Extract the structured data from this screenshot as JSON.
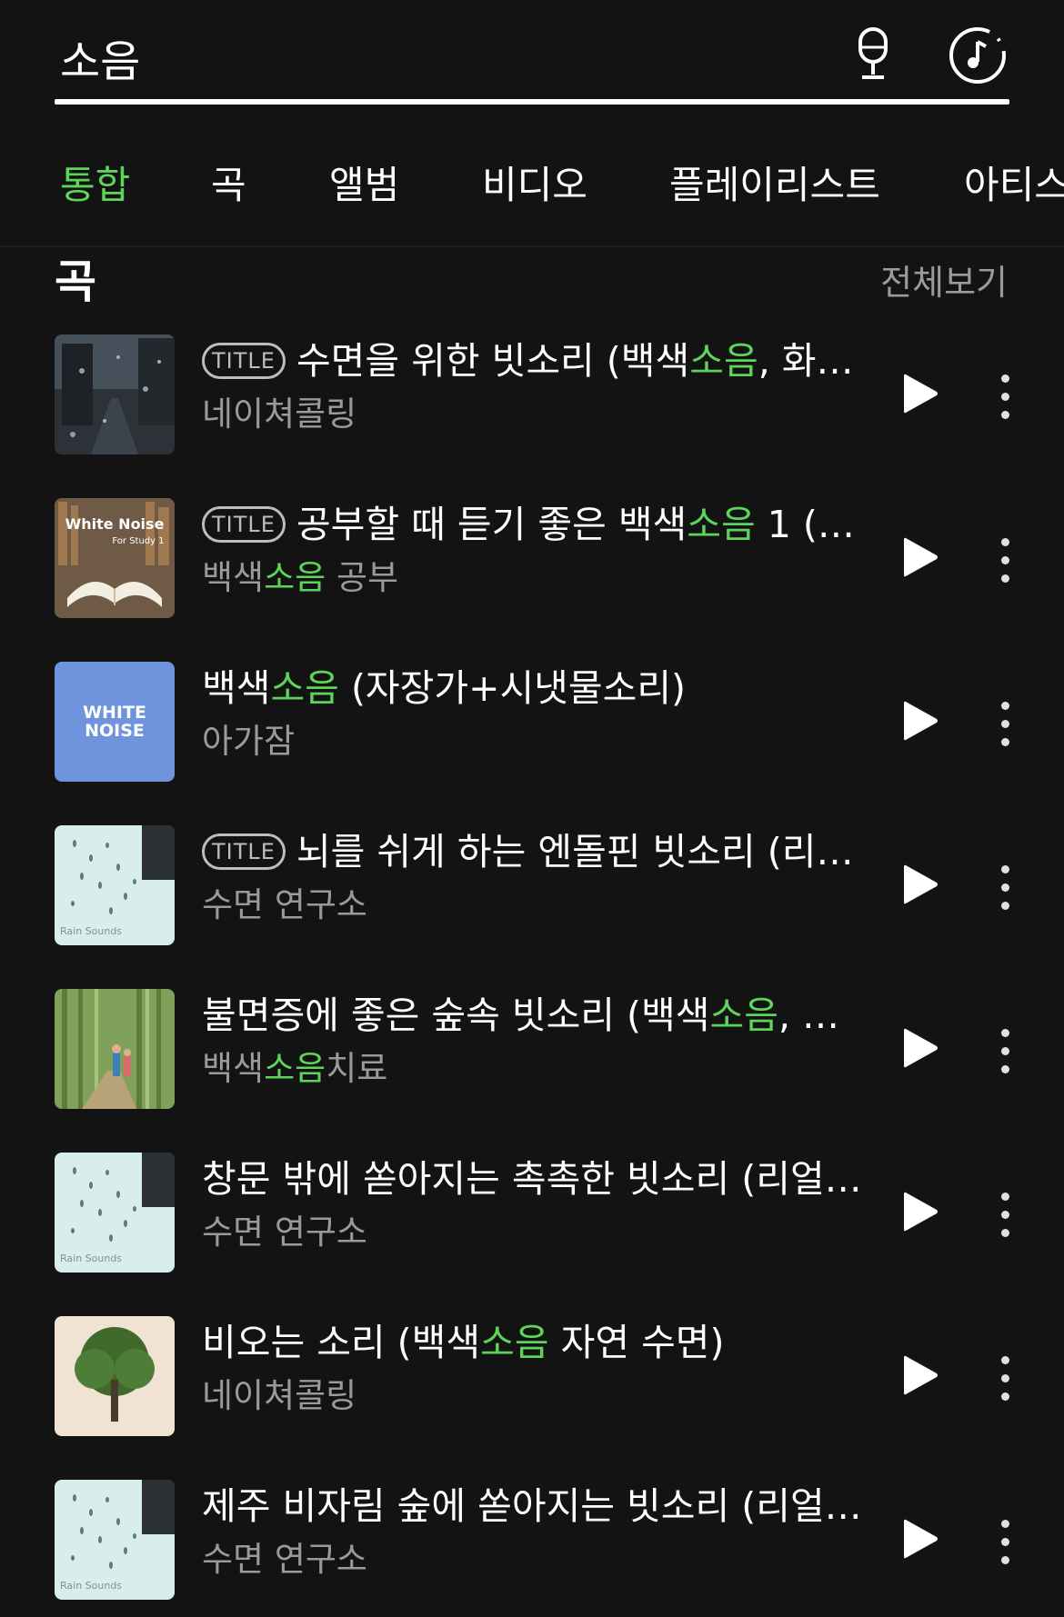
{
  "search": {
    "query": "소음"
  },
  "tabs": [
    {
      "label": "통합",
      "active": true
    },
    {
      "label": "곡",
      "active": false
    },
    {
      "label": "앨범",
      "active": false
    },
    {
      "label": "비디오",
      "active": false
    },
    {
      "label": "플레이리스트",
      "active": false
    },
    {
      "label": "아티스트",
      "active": false
    }
  ],
  "section": {
    "title": "곡",
    "see_all": "전체보기"
  },
  "badge_label": "TITLE",
  "highlight_color": "#5dd45a",
  "songs": [
    {
      "title_parts": [
        "수면을 위한 빗소리 (백색",
        "소음",
        ", 화…"
      ],
      "badge": true,
      "artist_parts": [
        "네이쳐콜링",
        "",
        ""
      ],
      "cover": "rainy-city-street"
    },
    {
      "title_parts": [
        "공부할 때 듣기 좋은 백색",
        "소음",
        " 1 (…"
      ],
      "badge": true,
      "artist_parts": [
        "백색",
        "소음",
        " 공부"
      ],
      "cover": "white-noise-for-study-book",
      "cover_text": [
        "White Noise",
        "For Study 1"
      ]
    },
    {
      "title_parts": [
        "백색",
        "소음",
        " (자장가+시냇물소리)"
      ],
      "badge": false,
      "artist_parts": [
        "아가잠",
        "",
        ""
      ],
      "cover": "white-noise-blue",
      "cover_text": [
        "WHITE",
        "NOISE"
      ]
    },
    {
      "title_parts": [
        "뇌를 쉬게 하는 엔돌핀 빗소리 (리…",
        "",
        ""
      ],
      "badge": true,
      "artist_parts": [
        "수면 연구소",
        "",
        ""
      ],
      "cover": "rain-drops-window",
      "cover_text": [
        "Rain Sounds"
      ]
    },
    {
      "title_parts": [
        "불면증에 좋은 숲속 빗소리 (백색",
        "소음",
        ", …"
      ],
      "badge": false,
      "artist_parts": [
        "백색",
        "소음",
        "치료"
      ],
      "cover": "bamboo-forest"
    },
    {
      "title_parts": [
        "창문 밖에 쏟아지는 촉촉한 빗소리 (리얼…",
        "",
        ""
      ],
      "badge": false,
      "artist_parts": [
        "수면 연구소",
        "",
        ""
      ],
      "cover": "rain-drops-window",
      "cover_text": [
        "Rain Sounds"
      ]
    },
    {
      "title_parts": [
        "비오는 소리 (백색",
        "소음",
        " 자연 수면)"
      ],
      "badge": false,
      "artist_parts": [
        "네이쳐콜링",
        "",
        ""
      ],
      "cover": "green-tree"
    },
    {
      "title_parts": [
        "제주 비자림 숲에 쏟아지는 빗소리 (리얼…",
        "",
        ""
      ],
      "badge": false,
      "artist_parts": [
        "수면 연구소",
        "",
        ""
      ],
      "cover": "rain-drops-window",
      "cover_text": [
        "Rain Sounds"
      ]
    }
  ]
}
